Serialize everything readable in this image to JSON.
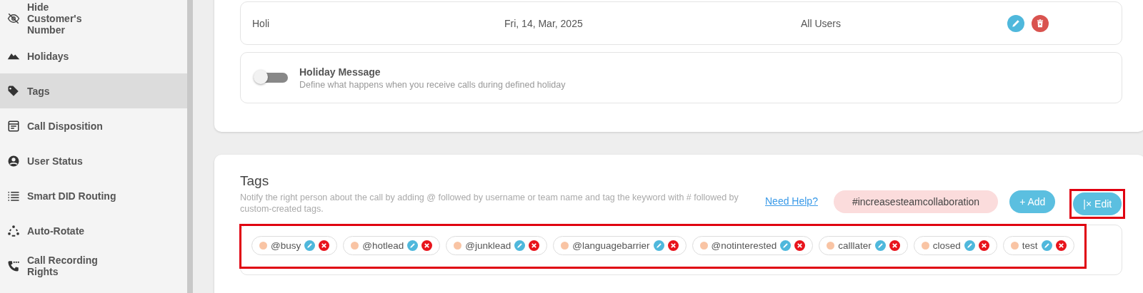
{
  "sidebar": {
    "items": [
      {
        "label": "Hide Customer's Number",
        "selected": false
      },
      {
        "label": "Holidays",
        "selected": false
      },
      {
        "label": "Tags",
        "selected": true
      },
      {
        "label": "Call Disposition",
        "selected": false
      },
      {
        "label": "User Status",
        "selected": false
      },
      {
        "label": "Smart DID Routing",
        "selected": false
      },
      {
        "label": "Auto-Rotate",
        "selected": false
      },
      {
        "label": "Call Recording Rights",
        "selected": false
      }
    ]
  },
  "holidays": {
    "rows": [
      {
        "name": "Holi",
        "date": "Fri, 14, Mar, 2025",
        "applies_to": "All Users"
      }
    ],
    "holiday_message": {
      "title": "Holiday Message",
      "description": "Define what happens when you receive calls during defined holiday",
      "on": false
    }
  },
  "tags": {
    "title": "Tags",
    "description": "Notify the right person about the call by adding @ followed by username or team name and tag the keyword with # followed by custom-created tags.",
    "help_link": "Need Help?",
    "hashtag": "#increasesteamcollaboration",
    "add_button": "+ Add",
    "edit_button": "|× Edit",
    "items": [
      {
        "label": "@busy"
      },
      {
        "label": "@hotlead"
      },
      {
        "label": "@junklead"
      },
      {
        "label": "@languagebarrier"
      },
      {
        "label": "@notinterested"
      },
      {
        "label": "calllater"
      },
      {
        "label": "closed"
      },
      {
        "label": "test"
      }
    ]
  }
}
